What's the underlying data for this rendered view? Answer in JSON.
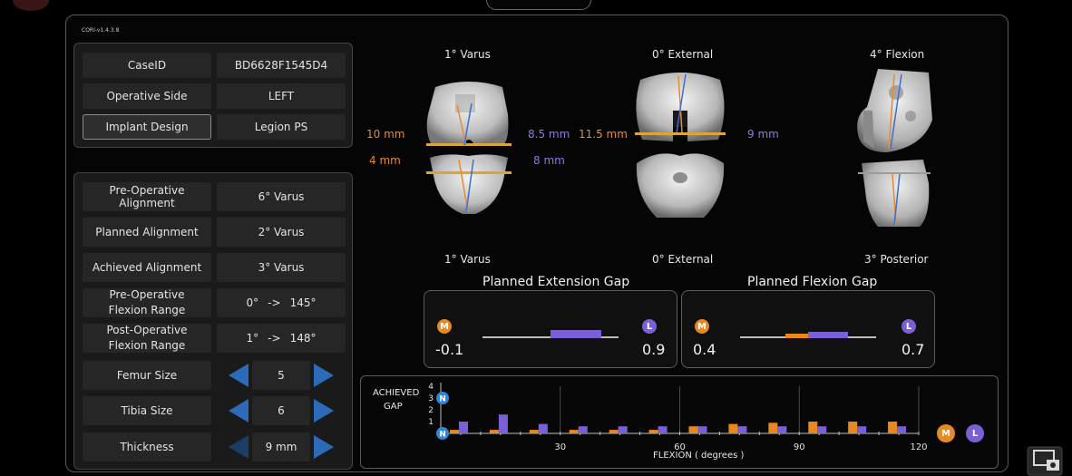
{
  "version": "CORI-v1.4.3.8",
  "case_info": {
    "rows": [
      {
        "label": "CaseID",
        "value": "BD6628F1545D4"
      },
      {
        "label": "Operative Side",
        "value": "LEFT"
      },
      {
        "label": "Implant Design",
        "value": "Legion PS"
      }
    ]
  },
  "alignment": {
    "pre_op_alignment": {
      "label": "Pre-Operative Alignment",
      "value": "6° Varus"
    },
    "planned_alignment": {
      "label": "Planned Alignment",
      "value": "2° Varus"
    },
    "achieved_alignment": {
      "label": "Achieved Alignment",
      "value": "3° Varus"
    },
    "pre_op_flexion": {
      "label": "Pre-Operative Flexion Range",
      "from": "0°",
      "arrow": "->",
      "to": "145°"
    },
    "post_op_flexion": {
      "label": "Post-Operative Flexion Range",
      "from": "1°",
      "arrow": "->",
      "to": "148°"
    },
    "femur_size": {
      "label": "Femur Size",
      "value": "5"
    },
    "tibia_size": {
      "label": "Tibia Size",
      "value": "6"
    },
    "thickness": {
      "label": "Thickness",
      "value": "9 mm"
    }
  },
  "views": {
    "front_top": "1° Varus",
    "front_bottom": "1° Varus",
    "axial_top": "0° External",
    "axial_bottom": "0° External",
    "side_top": "4° Flexion",
    "side_bottom": "3° Posterior",
    "measure_10": "10 mm",
    "measure_4": "4 mm",
    "measure_85": "8.5 mm",
    "measure_8": "8 mm",
    "measure_115": "11.5 mm",
    "measure_9": "9 mm"
  },
  "extension_gap": {
    "title": "Planned Extension Gap",
    "medial_badge": "M",
    "lateral_badge": "L",
    "medial_value": "-0.1",
    "lateral_value": "0.9",
    "medial": -0.1,
    "lateral": 0.9
  },
  "flexion_gap": {
    "title": "Planned Flexion Gap",
    "medial_badge": "M",
    "lateral_badge": "L",
    "medial_value": "0.4",
    "lateral_value": "0.7",
    "medial": 0.4,
    "lateral": 0.7
  },
  "chart_data": {
    "type": "bar",
    "ylabel_line1": "ACHIEVED",
    "ylabel_line2": "GAP",
    "xlabel": "FLEXION  ( degrees )",
    "y_ticks": [
      "4",
      "3",
      "2",
      "1"
    ],
    "x_ticks": [
      "30",
      "60",
      "90",
      "120"
    ],
    "xlim": [
      0,
      120
    ],
    "ylim": [
      0,
      4
    ],
    "neutral_badge": "N",
    "x": [
      0,
      10,
      20,
      30,
      40,
      50,
      60,
      70,
      80,
      90,
      100,
      110
    ],
    "series": [
      {
        "name": "M",
        "values": [
          0.3,
          0.3,
          0.3,
          0.3,
          0.3,
          0.3,
          0.6,
          0.8,
          0.9,
          1.0,
          1.0,
          1.0
        ],
        "color": "#e8891f"
      },
      {
        "name": "L",
        "values": [
          1.0,
          1.6,
          0.8,
          0.6,
          0.6,
          0.6,
          0.6,
          0.6,
          0.6,
          0.6,
          0.6,
          0.6
        ],
        "color": "#7b5fd6"
      }
    ],
    "legend_badges": [
      "M",
      "L"
    ]
  },
  "colors": {
    "accent": "#2b6bb7",
    "medial": "#e8891f",
    "lateral": "#7b5fd6"
  },
  "icons": {
    "screenshot_icon": "screenshot-icon"
  }
}
